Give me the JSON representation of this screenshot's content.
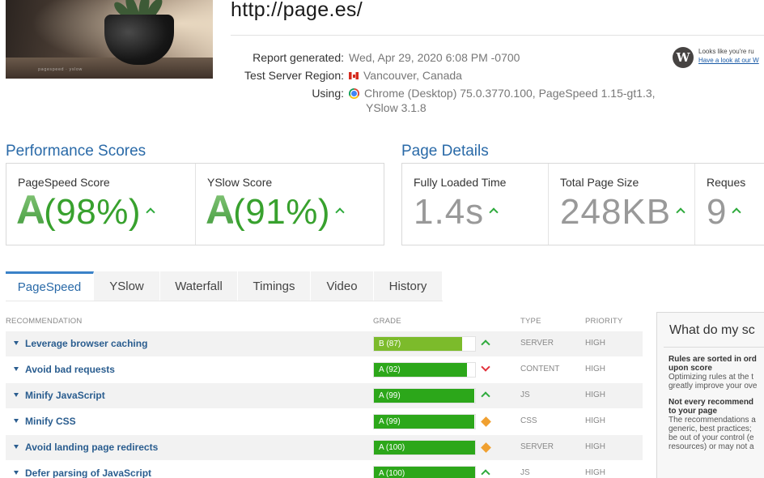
{
  "header": {
    "url": "http://page.es/",
    "thumbnail_caption": "pagespeed · yslow",
    "report_generated_label": "Report generated:",
    "report_generated_value": "Wed, Apr 29, 2020 6:08 PM -0700",
    "region_label": "Test Server Region:",
    "region_value": "Vancouver, Canada",
    "using_label": "Using:",
    "using_value_line1": "Chrome (Desktop) 75.0.3770.100, PageSpeed 1.15-gt1.3,",
    "using_value_line2": "YSlow 3.1.8",
    "wp_text_line1": "Looks like you're ru",
    "wp_text_line2": "Have a look at our W"
  },
  "performance": {
    "title": "Performance Scores",
    "pagespeed": {
      "label": "PageSpeed Score",
      "grade": "A",
      "percent": "(98%)"
    },
    "yslow": {
      "label": "YSlow Score",
      "grade": "A",
      "percent": "(91%)"
    }
  },
  "details": {
    "title": "Page Details",
    "loaded": {
      "label": "Fully Loaded Time",
      "value": "1.4s"
    },
    "size": {
      "label": "Total Page Size",
      "value": "248KB"
    },
    "requests": {
      "label": "Reques",
      "value": "9"
    }
  },
  "tabs": [
    "PageSpeed",
    "YSlow",
    "Waterfall",
    "Timings",
    "Video",
    "History"
  ],
  "active_tab": "PageSpeed",
  "table": {
    "headers": {
      "recommendation": "RECOMMENDATION",
      "grade": "GRADE",
      "type": "TYPE",
      "priority": "PRIORITY"
    },
    "rows": [
      {
        "name": "Leverage browser caching",
        "grade": "B (87)",
        "score": 87,
        "trend": "up",
        "type": "SERVER",
        "priority": "HIGH"
      },
      {
        "name": "Avoid bad requests",
        "grade": "A (92)",
        "score": 92,
        "trend": "down",
        "type": "CONTENT",
        "priority": "HIGH"
      },
      {
        "name": "Minify JavaScript",
        "grade": "A (99)",
        "score": 99,
        "trend": "up",
        "type": "JS",
        "priority": "HIGH"
      },
      {
        "name": "Minify CSS",
        "grade": "A (99)",
        "score": 99,
        "trend": "same",
        "type": "CSS",
        "priority": "HIGH"
      },
      {
        "name": "Avoid landing page redirects",
        "grade": "A (100)",
        "score": 100,
        "trend": "same",
        "type": "SERVER",
        "priority": "HIGH"
      },
      {
        "name": "Defer parsing of JavaScript",
        "grade": "A (100)",
        "score": 100,
        "trend": "up",
        "type": "JS",
        "priority": "HIGH"
      }
    ]
  },
  "help": {
    "title": "What do my sc",
    "h1_line1": "Rules are sorted in ord",
    "h1_line2": "upon score",
    "p1_line1": "Optimizing rules at the t",
    "p1_line2": "greatly improve your ove",
    "h2_line1": "Not every recommend",
    "h2_line2": "to your page",
    "p2_line1": "The recommendations a",
    "p2_line2": "generic, best practices;",
    "p2_line3": "be out of your control (e",
    "p2_line4": "resources) or may not a"
  },
  "colors": {
    "accent": "#2a6aa8",
    "grade_a": "#2ca71a",
    "grade_b": "#7cbb2b",
    "trend_up": "#2eaa3c",
    "trend_down": "#e2323c",
    "trend_same": "#f0a030"
  }
}
